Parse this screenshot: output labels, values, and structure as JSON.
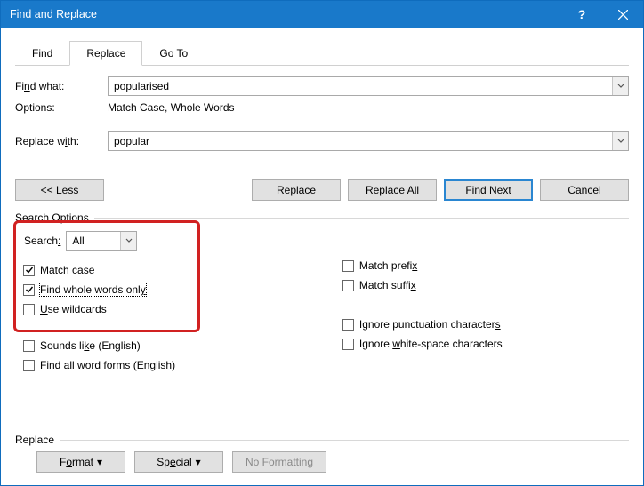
{
  "title": "Find and Replace",
  "tabs": {
    "find": "Find",
    "replace": "Replace",
    "goto": "Go To"
  },
  "find": {
    "label": "Find what:",
    "value": "popularised",
    "options_label": "Options:",
    "options_value": "Match Case, Whole Words"
  },
  "replace": {
    "label": "Replace with:",
    "value": "popular"
  },
  "buttons": {
    "less": "<< Less",
    "replace": "Replace",
    "replace_all": "Replace All",
    "find_next": "Find Next",
    "cancel": "Cancel"
  },
  "search_options": {
    "header": "Search Options",
    "search_label": "Search:",
    "search_value": "All",
    "match_case": "Match case",
    "whole_words": "Find whole words only",
    "wildcards": "Use wildcards",
    "sounds_like": "Sounds like (English)",
    "word_forms": "Find all word forms (English)",
    "match_prefix": "Match prefix",
    "match_suffix": "Match suffix",
    "ignore_punct": "Ignore punctuation characters",
    "ignore_ws": "Ignore white-space characters"
  },
  "bottom": {
    "header": "Replace",
    "format": "Format",
    "special": "Special",
    "no_formatting": "No Formatting"
  }
}
